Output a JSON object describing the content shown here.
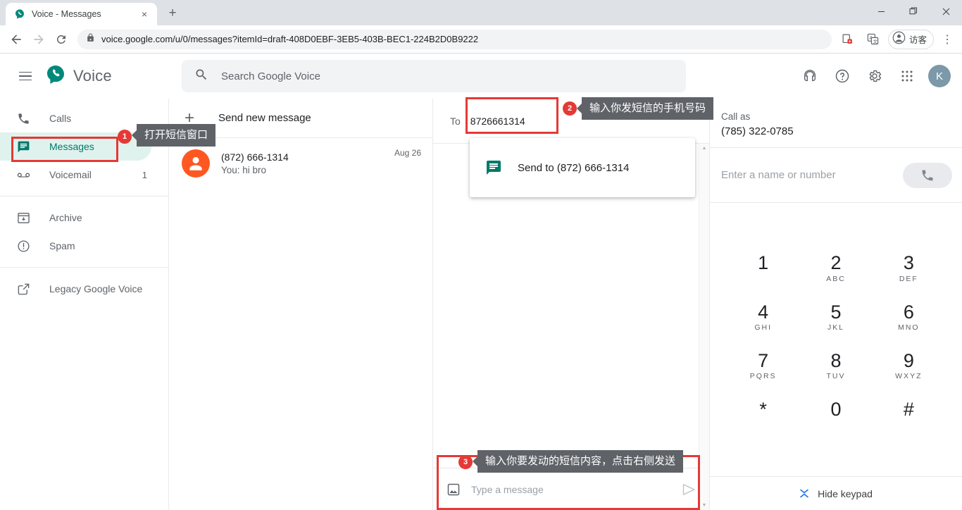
{
  "browser": {
    "tab": {
      "title": "Voice - Messages",
      "favicon": "google-voice-icon",
      "close": "×"
    },
    "newtab_label": "+",
    "window_controls": {
      "minimize": "—",
      "maximize": "❐",
      "close": "✕"
    },
    "nav": {
      "back": "←",
      "forward": "→",
      "reload": "↻"
    },
    "url": "voice.google.com/u/0/messages?itemId=draft-408D0EBF-3EB5-403B-BEC1-224B2D0B9222",
    "lock_icon": "lock-icon",
    "profile_name": "访客",
    "menu": "⋮"
  },
  "appbar": {
    "menu_icon": "hamburger-icon",
    "brand": "Voice",
    "search_placeholder": "Search Google Voice",
    "icons": [
      "headset-icon",
      "help-icon",
      "settings-icon",
      "apps-grid-icon"
    ],
    "avatar_initial": "K"
  },
  "sidebar": {
    "items": [
      {
        "label": "Calls",
        "icon": "phone-icon",
        "count": "",
        "active": false
      },
      {
        "label": "Messages",
        "icon": "message-icon",
        "count": "",
        "active": true
      },
      {
        "label": "Voicemail",
        "icon": "voicemail-icon",
        "count": "1",
        "active": false
      },
      {
        "label": "Archive",
        "icon": "archive-icon",
        "count": "",
        "active": false
      },
      {
        "label": "Spam",
        "icon": "spam-icon",
        "count": "",
        "active": false
      },
      {
        "label": "Legacy Google Voice",
        "icon": "external-link-icon",
        "count": "",
        "active": false
      }
    ]
  },
  "conversations": {
    "new_message_label": "Send new message",
    "new_message_icon": "plus-icon",
    "items": [
      {
        "name": "(872) 666-1314",
        "snippet": "You: hi bro",
        "date": "Aug 26",
        "avatar": "person-icon"
      }
    ]
  },
  "compose": {
    "to_label": "To",
    "to_value": "8726661314",
    "suggestion": {
      "icon": "message-icon",
      "text": "Send to (872) 666-1314"
    },
    "message_placeholder": "Type a message",
    "image_icon": "image-icon",
    "send_icon": "send-icon",
    "scroll_up": "▲",
    "scroll_down": "▼"
  },
  "dialpane": {
    "call_as_label": "Call as",
    "call_as_number": "(785) 322-0785",
    "dial_placeholder": "Enter a name or number",
    "call_icon": "phone-icon",
    "keys": [
      {
        "digit": "1",
        "letters": ""
      },
      {
        "digit": "2",
        "letters": "ABC"
      },
      {
        "digit": "3",
        "letters": "DEF"
      },
      {
        "digit": "4",
        "letters": "GHI"
      },
      {
        "digit": "5",
        "letters": "JKL"
      },
      {
        "digit": "6",
        "letters": "MNO"
      },
      {
        "digit": "7",
        "letters": "PQRS"
      },
      {
        "digit": "8",
        "letters": "TUV"
      },
      {
        "digit": "9",
        "letters": "WXYZ"
      },
      {
        "digit": "*",
        "letters": ""
      },
      {
        "digit": "0",
        "letters": ""
      },
      {
        "digit": "#",
        "letters": ""
      }
    ],
    "hide_keypad_label": "Hide keypad"
  },
  "annotations": {
    "accent_color": "#e53935",
    "tooltip_bg": "#5f6368",
    "items": [
      {
        "number": "1",
        "text": "打开短信窗口"
      },
      {
        "number": "2",
        "text": "输入你发短信的手机号码"
      },
      {
        "number": "3",
        "text": "输入你要发动的短信内容，点击右侧发送"
      }
    ]
  }
}
